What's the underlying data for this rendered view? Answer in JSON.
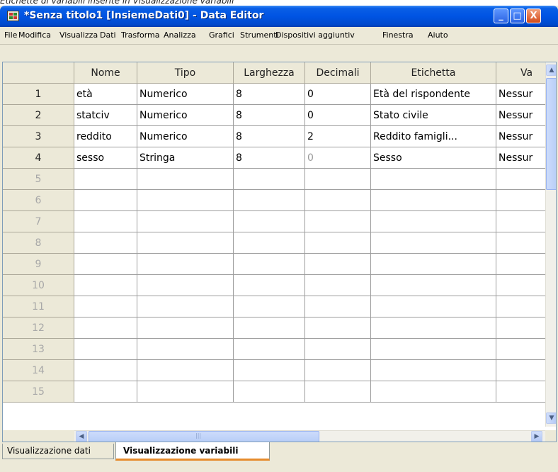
{
  "caption": "Etichette di variabili inserite in Visualizzazione variabili",
  "window": {
    "title": "*Senza titolo1 [InsiemeDati0] - Data Editor",
    "buttons": {
      "minimize": "_",
      "maximize": "□",
      "close": "X"
    }
  },
  "menu": [
    "File",
    "Modifica",
    "Visualizza",
    "Dati",
    "Trasforma",
    "Analizza",
    "Grafici",
    "Strumenti",
    "Dispositivi aggiuntiv",
    "Finestra",
    "Aiuto"
  ],
  "grid": {
    "headers": [
      "Nome",
      "Tipo",
      "Larghezza",
      "Decimali",
      "Etichetta",
      "Va"
    ],
    "rows": [
      {
        "num": "1",
        "cells": [
          "età",
          "Numerico",
          "8",
          "0",
          "Età del rispondente",
          "Nessur"
        ]
      },
      {
        "num": "2",
        "cells": [
          "statciv",
          "Numerico",
          "8",
          "0",
          "Stato civile",
          "Nessur"
        ]
      },
      {
        "num": "3",
        "cells": [
          "reddito",
          "Numerico",
          "8",
          "2",
          "Reddito famigli...",
          "Nessur"
        ]
      },
      {
        "num": "4",
        "cells": [
          "sesso",
          "Stringa",
          "8",
          "0",
          "Sesso",
          "Nessur"
        ]
      },
      {
        "num": "5",
        "cells": [
          "",
          "",
          "",
          "",
          "",
          ""
        ]
      },
      {
        "num": "6",
        "cells": [
          "",
          "",
          "",
          "",
          "",
          ""
        ]
      },
      {
        "num": "7",
        "cells": [
          "",
          "",
          "",
          "",
          "",
          ""
        ]
      },
      {
        "num": "8",
        "cells": [
          "",
          "",
          "",
          "",
          "",
          ""
        ]
      },
      {
        "num": "9",
        "cells": [
          "",
          "",
          "",
          "",
          "",
          ""
        ]
      },
      {
        "num": "10",
        "cells": [
          "",
          "",
          "",
          "",
          "",
          ""
        ]
      },
      {
        "num": "11",
        "cells": [
          "",
          "",
          "",
          "",
          "",
          ""
        ]
      },
      {
        "num": "12",
        "cells": [
          "",
          "",
          "",
          "",
          "",
          ""
        ]
      },
      {
        "num": "13",
        "cells": [
          "",
          "",
          "",
          "",
          "",
          ""
        ]
      },
      {
        "num": "14",
        "cells": [
          "",
          "",
          "",
          "",
          "",
          ""
        ]
      },
      {
        "num": "15",
        "cells": [
          "",
          "",
          "",
          "",
          "",
          ""
        ]
      }
    ]
  },
  "scrollbars": {
    "up": "▲",
    "down": "▼",
    "left": "◀",
    "right": "▶",
    "grip": "|||"
  },
  "tabs": [
    {
      "label": "Visualizzazione dati",
      "active": false
    },
    {
      "label": "Visualizzazione variabili",
      "active": true
    }
  ],
  "colors": {
    "title_bar": "#0054e3",
    "active_tab_accent": "#e68b2c",
    "disabled_row_number": "#a8a8a8"
  }
}
